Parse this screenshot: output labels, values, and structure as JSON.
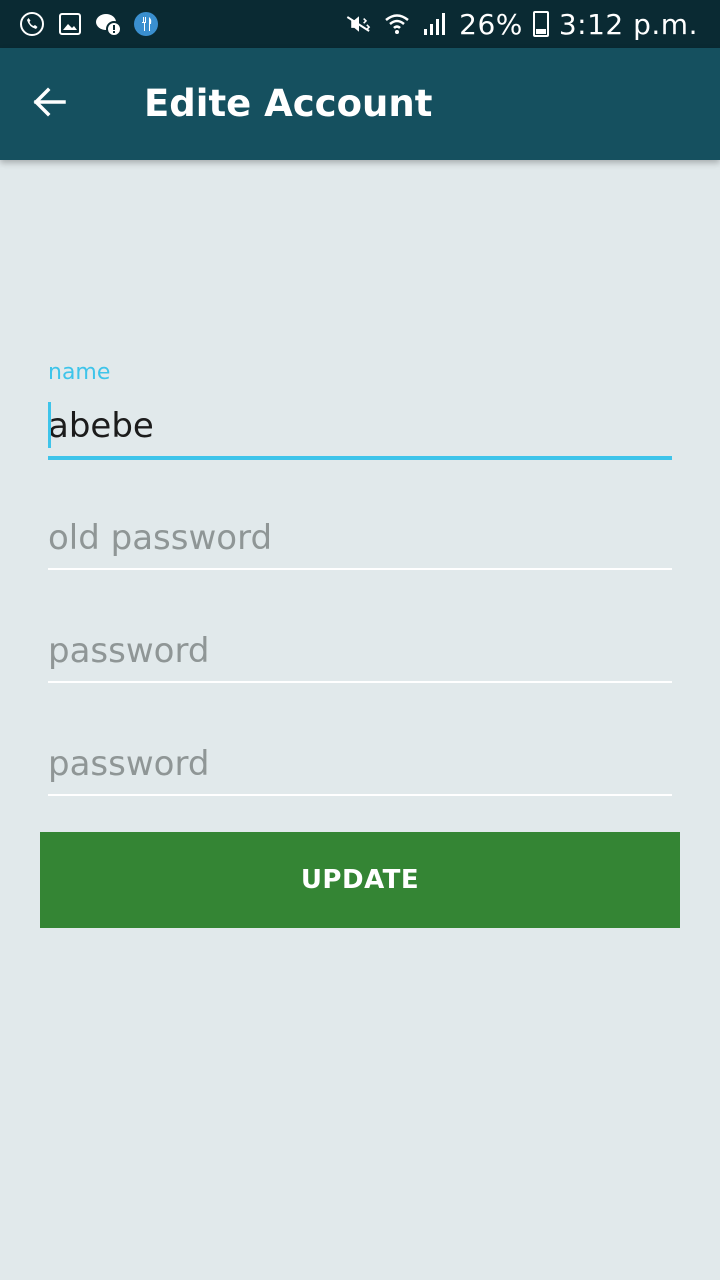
{
  "status_bar": {
    "battery_percent": "26%",
    "time": "3:12 p.m.",
    "left_icons": [
      "call-icon",
      "gallery-icon",
      "chat-alert-icon",
      "restaurant-icon"
    ],
    "right_icons": [
      "mute-icon",
      "wifi-icon",
      "signal-icon",
      "battery-icon"
    ]
  },
  "app_bar": {
    "title": "Edite Account",
    "back_icon": "arrow-left-icon"
  },
  "form": {
    "name": {
      "label": "name",
      "value": "abebe"
    },
    "old_password": {
      "placeholder": "old password",
      "value": ""
    },
    "password": {
      "placeholder": "password",
      "value": ""
    },
    "confirm_password": {
      "placeholder": "password",
      "value": ""
    },
    "update_label": "UPDATE"
  },
  "colors": {
    "status_bar": "#0a2a33",
    "app_bar": "#15505f",
    "background": "#e1e9eb",
    "accent": "#3ec4ea",
    "button": "#348534"
  }
}
